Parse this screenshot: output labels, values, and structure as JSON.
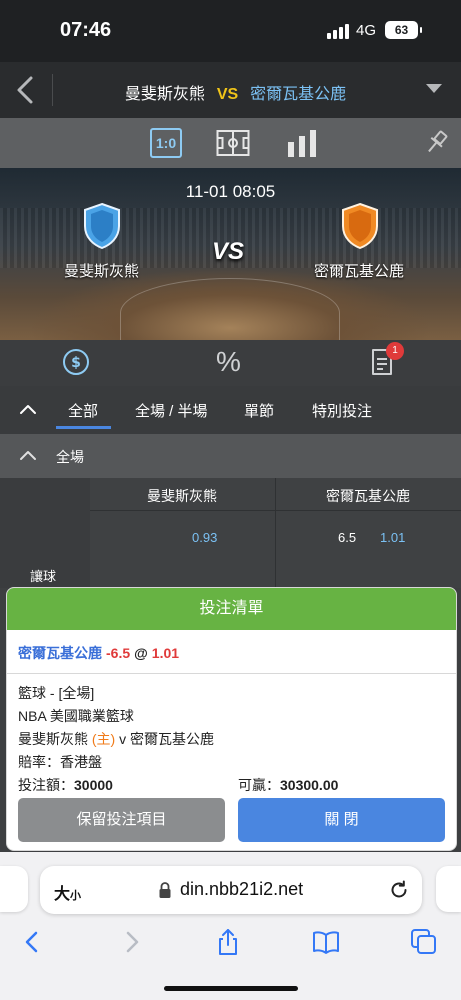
{
  "status_bar": {
    "time": "07:46",
    "network": "4G",
    "battery": "63"
  },
  "header": {
    "home_team": "曼斐斯灰熊",
    "vs": "VS",
    "away_team": "密爾瓦基公鹿"
  },
  "tools": {
    "score": "1:0"
  },
  "banner": {
    "datetime": "11-01 08:05",
    "vs": "VS",
    "home_team": "曼斐斯灰熊",
    "away_team": "密爾瓦基公鹿"
  },
  "icon_row": {
    "percent": "%",
    "notification_count": "1"
  },
  "tabs": [
    {
      "label": "全部"
    },
    {
      "label": "全場 / 半場"
    },
    {
      "label": "單節"
    },
    {
      "label": "特別投注"
    }
  ],
  "section": {
    "title": "全場"
  },
  "odds_table": {
    "columns": [
      "曼斐斯灰熊",
      "密爾瓦基公鹿"
    ],
    "row_label": "讓球",
    "home_odds": "0.93",
    "away_handicap": "6.5",
    "away_odds": "1.01"
  },
  "bet_slip": {
    "title": "投注清單",
    "selection_team": "密爾瓦基公鹿",
    "selection_handicap": "-6.5",
    "selection_at": "@",
    "selection_odds": "1.01",
    "sport": "籃球 - [全場]",
    "league": "NBA 美國職業籃球",
    "match_home": "曼斐斯灰熊",
    "home_tag": "(主)",
    "match_rest": "v 密爾瓦基公鹿",
    "odds_type": "賠率：香港盤",
    "stake_label": "投注額：",
    "stake_value": "30000",
    "win_label": "可贏：",
    "win_value": "30300.00",
    "keep_button": "保留投注項目",
    "close_button": "關 閉"
  },
  "browser": {
    "text_size_big": "大",
    "text_size_small": "小",
    "url": "din.nbb21i2.net"
  },
  "colors": {
    "accent_blue": "#4a86e0",
    "slip_green": "#67b343",
    "vs_yellow": "#f0c419",
    "away_blue": "#7bc1f4",
    "alert_red": "#e03a3a",
    "home_shield": "#4aa3e6",
    "away_shield": "#f08a24"
  }
}
